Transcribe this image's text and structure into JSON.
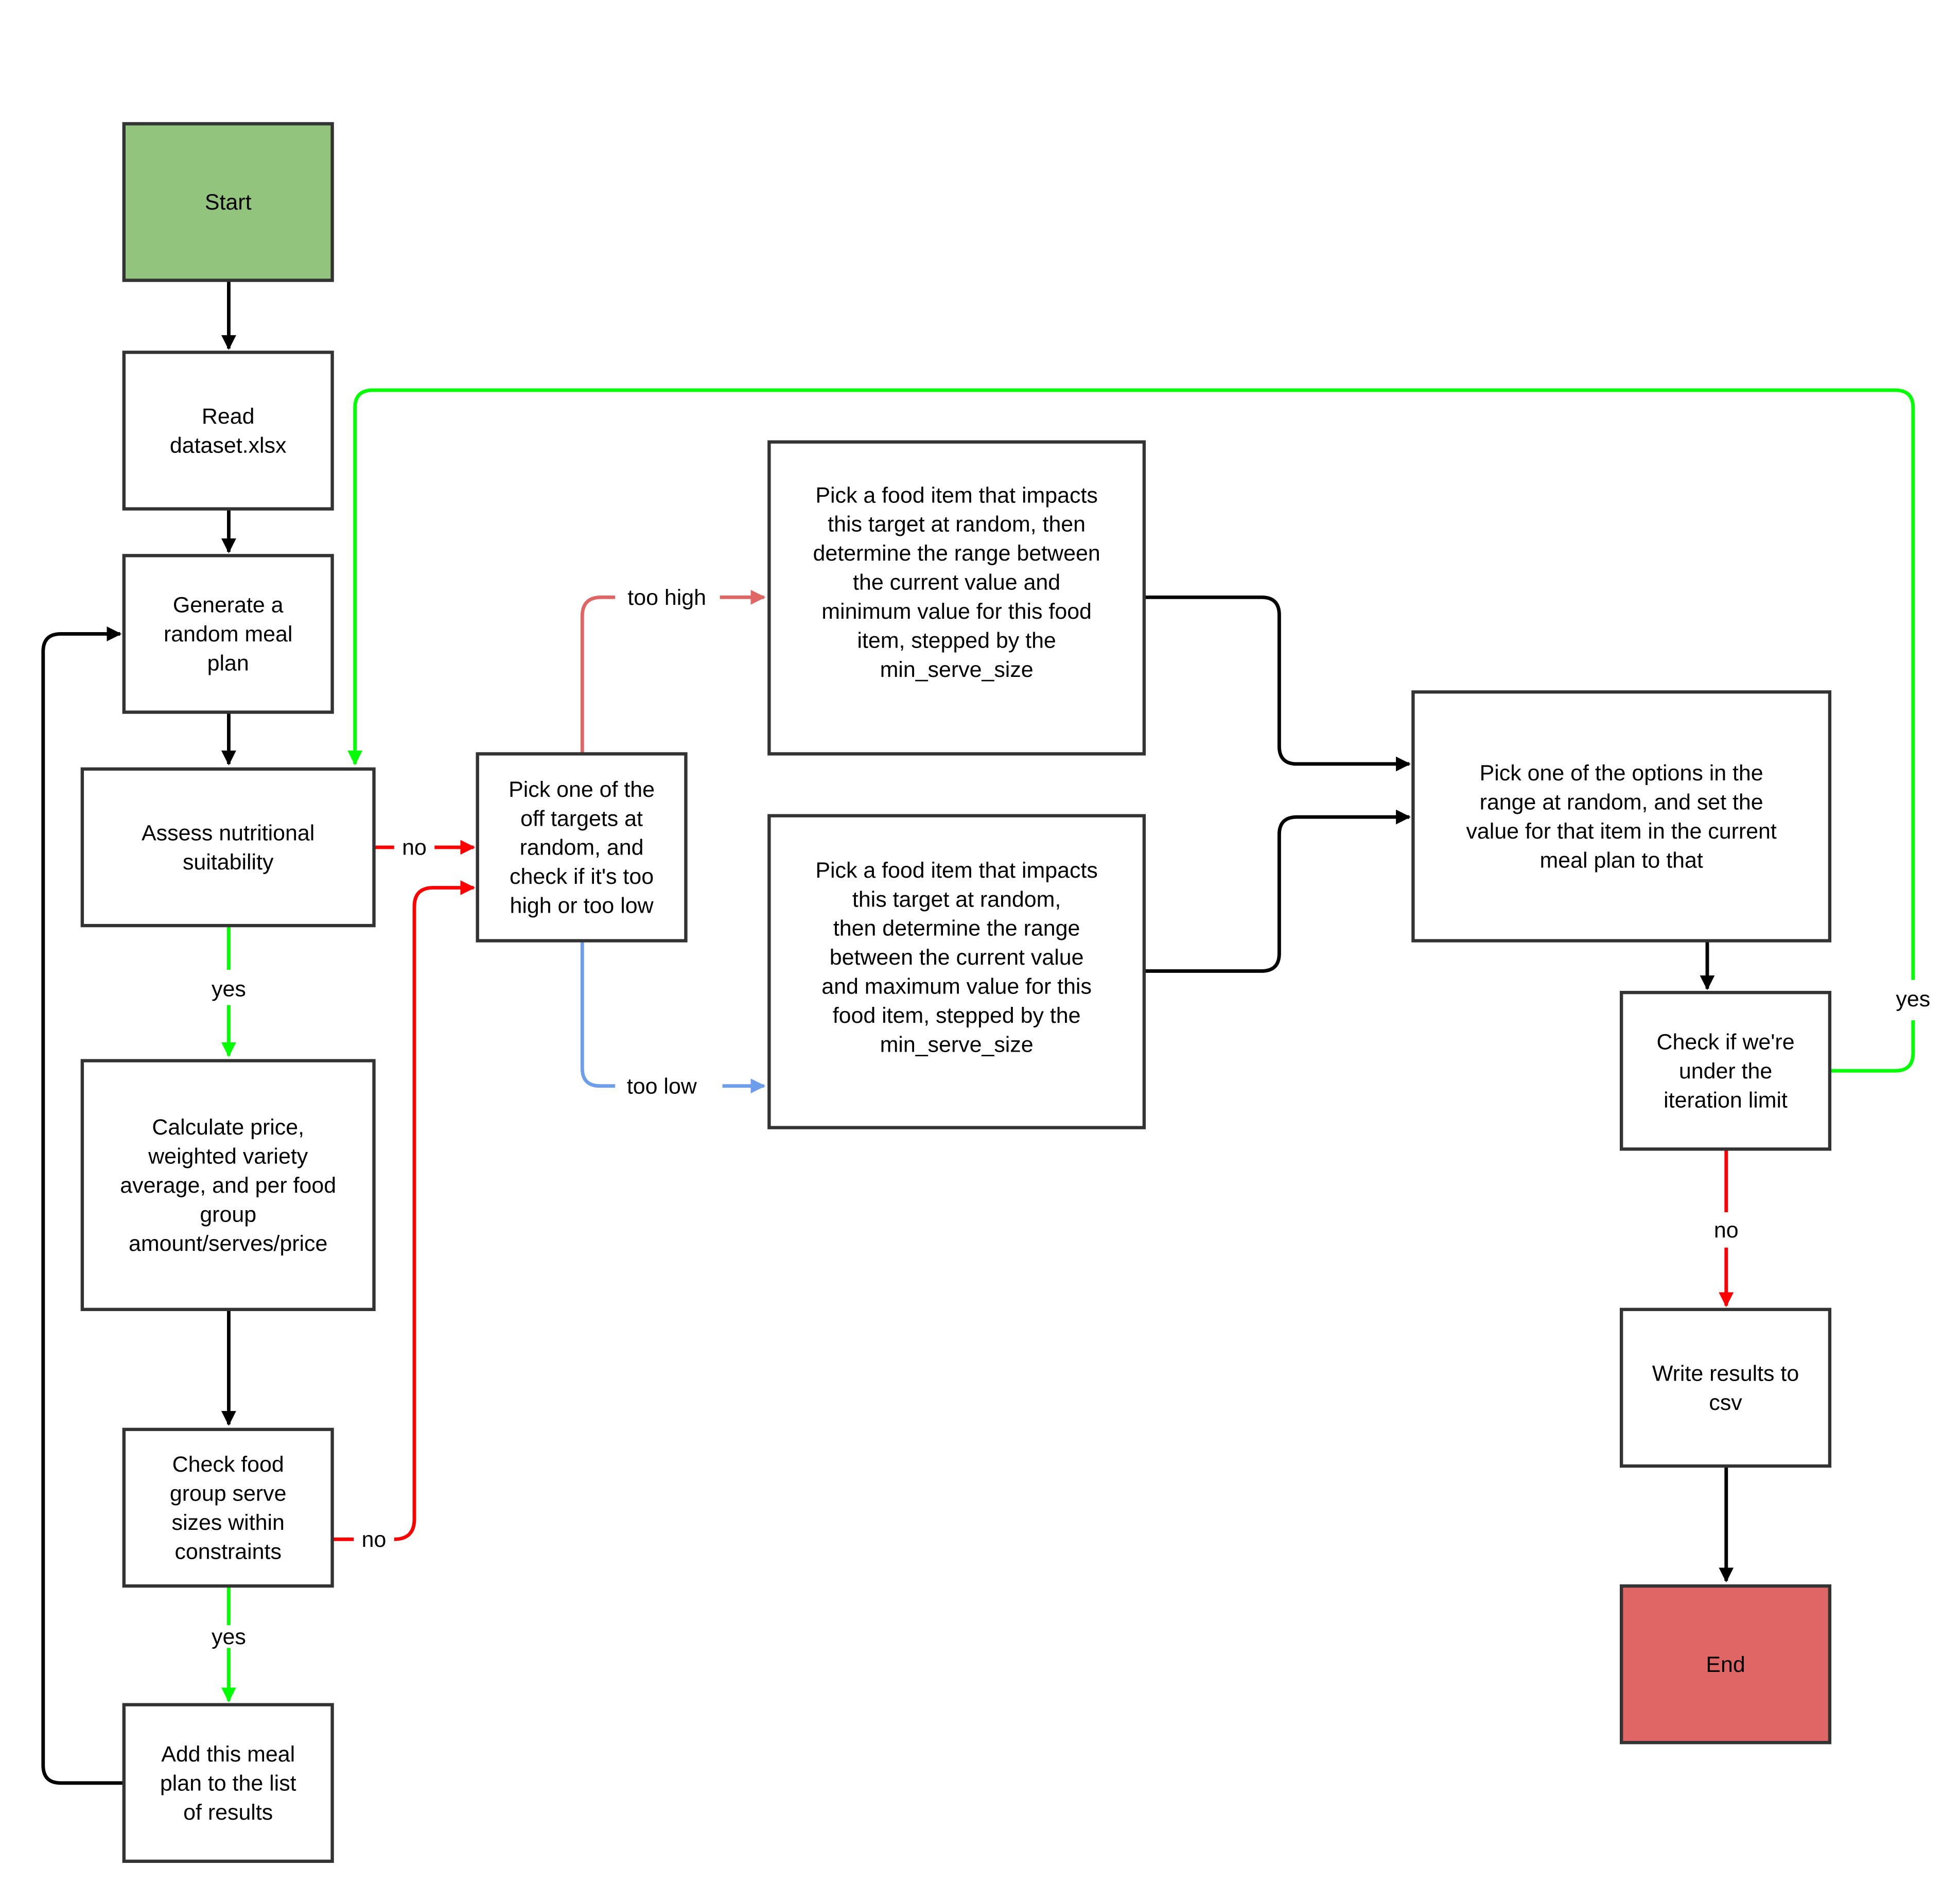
{
  "colors": {
    "start_fill": "#93c47d",
    "end_fill": "#e06666",
    "box_fill": "#ffffff",
    "box_stroke": "#333333",
    "flow_black": "#000000",
    "yes_green": "#00ff00",
    "no_red": "#ff0000",
    "too_high": "#e06666",
    "too_low": "#6d9eeb"
  },
  "nodes": {
    "start": {
      "lines": [
        "Start"
      ]
    },
    "read": {
      "lines": [
        "Read",
        "dataset.xlsx"
      ]
    },
    "generate": {
      "lines": [
        "Generate a",
        "random meal",
        "plan"
      ]
    },
    "assess": {
      "lines": [
        "Assess nutritional",
        "suitability"
      ]
    },
    "calculate": {
      "lines": [
        "Calculate price,",
        "weighted variety",
        "average, and per food",
        "group",
        "amount/serves/price"
      ]
    },
    "check_food": {
      "lines": [
        "Check food",
        "group serve",
        "sizes within",
        "constraints"
      ]
    },
    "add_plan": {
      "lines": [
        "Add this meal",
        "plan to the list",
        "of results"
      ]
    },
    "pick_target": {
      "lines": [
        "Pick one of the",
        "off targets at",
        "random, and",
        "check if it's too",
        "high or too low"
      ]
    },
    "pick_high": {
      "lines": [
        "Pick a food item that impacts",
        "this target at random, then",
        "determine the range between",
        "the current value and",
        "minimum value for this food",
        "item, stepped by the",
        "min_serve_size"
      ]
    },
    "pick_low": {
      "lines": [
        "Pick a food item that impacts",
        "this target at random,",
        "then determine the range",
        "between the current value",
        "and maximum value for this",
        "food item, stepped by the",
        "min_serve_size"
      ]
    },
    "pick_option": {
      "lines": [
        "Pick one of the options in the",
        "range at random, and set the",
        "value for that item in the current",
        "meal plan to that"
      ]
    },
    "check_iter": {
      "lines": [
        "Check if we're",
        "under the",
        "iteration limit"
      ]
    },
    "write_csv": {
      "lines": [
        "Write results to",
        "csv"
      ]
    },
    "end": {
      "lines": [
        "End"
      ]
    }
  },
  "edge_labels": {
    "assess_no": "no",
    "assess_yes": "yes",
    "check_food_no": "no",
    "check_food_yes": "yes",
    "too_high": "too high",
    "too_low": "too low",
    "iter_yes": "yes",
    "iter_no": "no"
  }
}
